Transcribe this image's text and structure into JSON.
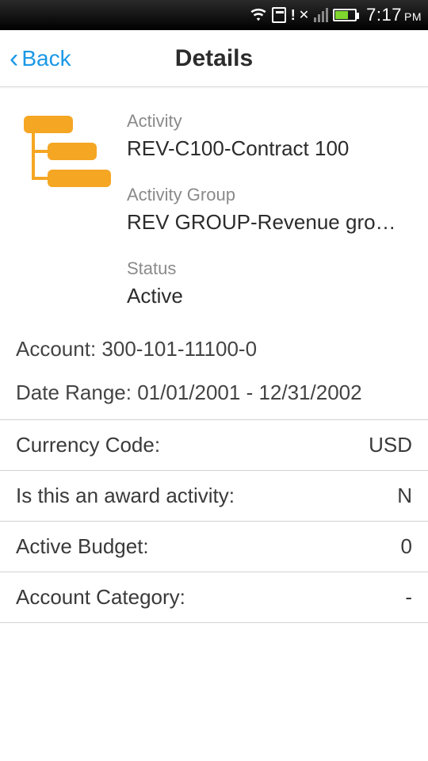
{
  "statusbar": {
    "time": "7:17",
    "ampm": "PM"
  },
  "nav": {
    "back_label": "Back",
    "title": "Details"
  },
  "header": {
    "activity_label": "Activity",
    "activity_value": "REV-C100-Contract 100",
    "group_label": "Activity Group",
    "group_value": "REV GROUP-Revenue gro…",
    "status_label": "Status",
    "status_value": "Active"
  },
  "plain": {
    "account_label": "Account: ",
    "account_value": "300-101-11100-0",
    "daterange_label": "Date Range: ",
    "daterange_value": "01/01/2001 - 12/31/2002"
  },
  "rows": {
    "currency_label": "Currency Code:",
    "currency_value": "USD",
    "award_label": "Is this an award activity:",
    "award_value": "N",
    "budget_label": "Active Budget:",
    "budget_value": "0",
    "category_label": "Account Category:",
    "category_value": "-"
  }
}
